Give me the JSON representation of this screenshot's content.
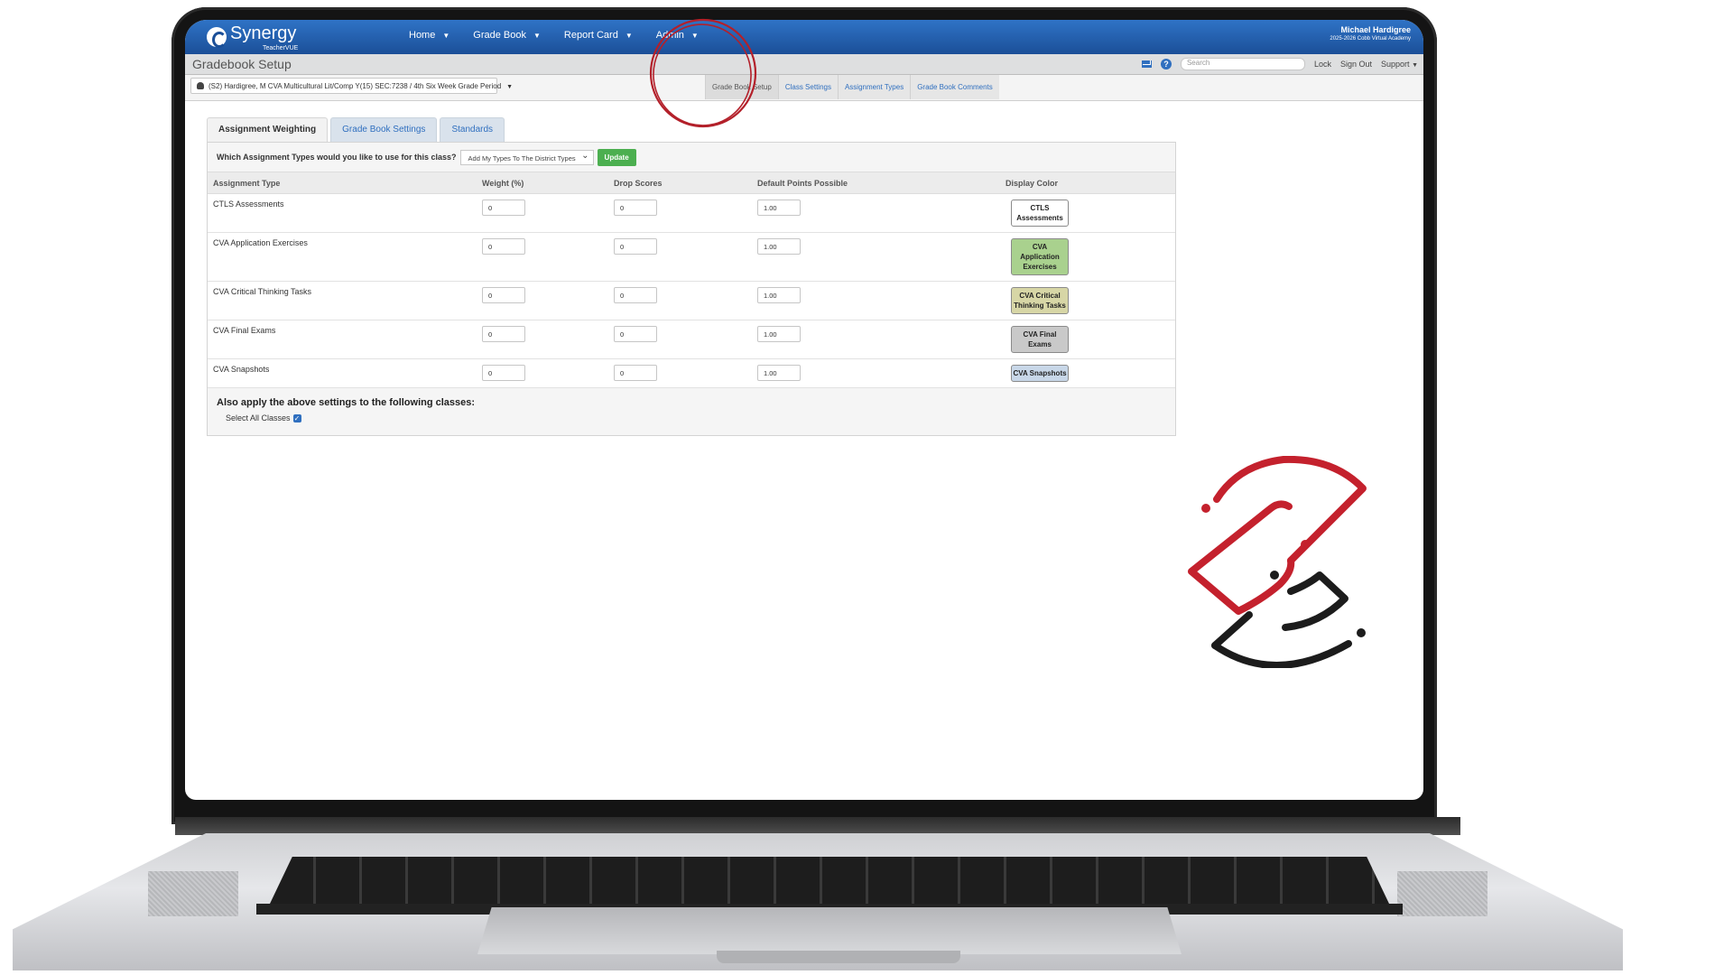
{
  "app": {
    "logo": "Synergy",
    "logo_sub": "TeacherVUE"
  },
  "nav": [
    {
      "label": "Home"
    },
    {
      "label": "Grade Book"
    },
    {
      "label": "Report Card"
    },
    {
      "label": "Admin"
    }
  ],
  "user": {
    "name": "Michael Hardigree",
    "school": "2025-2026 Cobb Virtual Academy"
  },
  "subbar": {
    "title": "Gradebook Setup",
    "search_placeholder": "Search",
    "lock": "Lock",
    "sign_out": "Sign Out",
    "support": "Support"
  },
  "class_select": {
    "value": "(S2) Hardigree, M CVA Multicultural Lit/Comp Y(15) SEC:7238 / 4th Six Week Grade Period"
  },
  "setup_tabs": [
    {
      "label": "Grade Book Setup"
    },
    {
      "label": "Class Settings"
    },
    {
      "label": "Assignment Types"
    },
    {
      "label": "Grade Book Comments"
    }
  ],
  "tabs": [
    {
      "label": "Assignment Weighting"
    },
    {
      "label": "Grade Book Settings"
    },
    {
      "label": "Standards"
    }
  ],
  "question": {
    "label": "Which Assignment Types would you like to use for this class?",
    "select_value": "Add My Types To The District Types",
    "update": "Update"
  },
  "table": {
    "headers": [
      "Assignment Type",
      "Weight (%)",
      "Drop Scores",
      "Default Points Possible",
      "Display Color"
    ],
    "rows": [
      {
        "type": "CTLS Assessments",
        "weight": "0",
        "drop": "0",
        "points": "1.00",
        "color_line1": "CTLS",
        "color_line2": "Assessments",
        "color_line3": "",
        "bg": "#ffffff"
      },
      {
        "type": "CVA Application Exercises",
        "weight": "0",
        "drop": "0",
        "points": "1.00",
        "color_line1": "CVA",
        "color_line2": "Application",
        "color_line3": "Exercises",
        "bg": "#a9d18e"
      },
      {
        "type": "CVA Critical Thinking Tasks",
        "weight": "0",
        "drop": "0",
        "points": "1.00",
        "color_line1": "CVA Critical",
        "color_line2": "Thinking Tasks",
        "color_line3": "",
        "bg": "#d7d6a6"
      },
      {
        "type": "CVA Final Exams",
        "weight": "0",
        "drop": "0",
        "points": "1.00",
        "color_line1": "CVA Final",
        "color_line2": "Exams",
        "color_line3": "",
        "bg": "#c9c9c9"
      },
      {
        "type": "CVA Snapshots",
        "weight": "0",
        "drop": "0",
        "points": "1.00",
        "color_line1": "CVA Snapshots",
        "color_line2": "",
        "color_line3": "",
        "bg": "#c8d7e8"
      }
    ]
  },
  "apply": {
    "title": "Also apply the above settings to the following classes:",
    "select_all": "Select All Classes",
    "checked": true
  },
  "colors": {
    "accent": "#2f6fbf",
    "topbar": "#1b4f98",
    "update": "#4caf50",
    "annotation": "#b3202a",
    "brand_red": "#c4212d",
    "brand_black": "#1c1c1c"
  }
}
